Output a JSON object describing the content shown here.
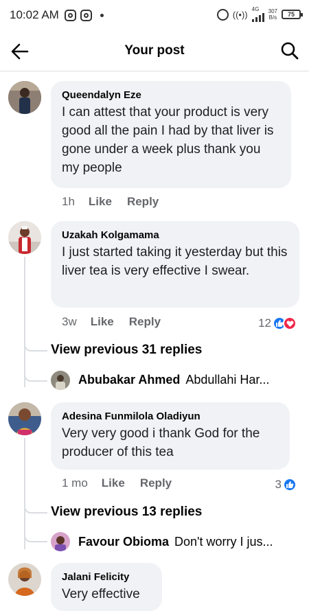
{
  "status_bar": {
    "time": "10:02 AM",
    "network": "4G",
    "speed_value": "307",
    "speed_unit": "B/s",
    "battery": "75"
  },
  "header": {
    "title": "Your post",
    "back_icon": "arrow-left-icon",
    "search_icon": "search-icon"
  },
  "comments": [
    {
      "author": "Queendalyn Eze",
      "text": "I can attest that your product is very good all the pain I had by that liver is gone under a week plus thank you my people",
      "time": "1h",
      "like_label": "Like",
      "reply_label": "Reply"
    },
    {
      "author": "Uzakah Kolgamama",
      "text": "I just started taking it yesterday but this liver tea is very effective I swear.",
      "time": "3w",
      "like_label": "Like",
      "reply_label": "Reply",
      "reaction_count": "12",
      "view_previous": "View previous 31 replies",
      "reply_author": "Abubakar Ahmed",
      "reply_preview": "Abdullahi Har..."
    },
    {
      "author": "Adesina Funmilola Oladiyun",
      "text": "Very very good i thank God for the producer of this tea",
      "time": "1 mo",
      "like_label": "Like",
      "reply_label": "Reply",
      "reaction_count": "3",
      "view_previous": "View previous 13 replies",
      "reply_author": "Favour Obioma",
      "reply_preview": "Don't worry I jus..."
    },
    {
      "author": "Jalani Felicity",
      "text": "Very effective"
    }
  ],
  "colors": {
    "like_blue": "#1877f2",
    "love_red": "#f0284a",
    "bubble_bg": "#f0f2f5",
    "meta_gray": "#65676b"
  }
}
